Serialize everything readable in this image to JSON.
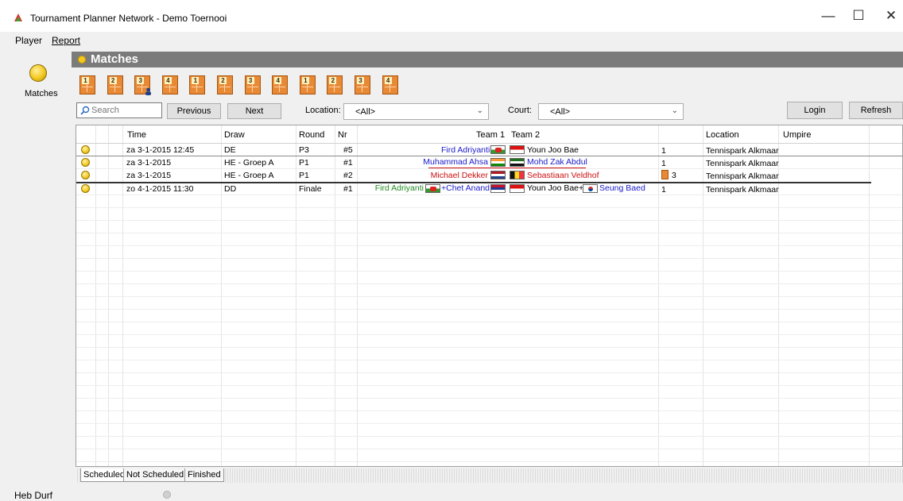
{
  "window": {
    "title": "Tournament Planner Network - Demo Toernooi",
    "minimize_glyph": "—",
    "maximize_glyph": "☐",
    "close_glyph": "✕"
  },
  "menu": {
    "player": "Player",
    "report": "Report"
  },
  "nav": {
    "matches_label": "Matches"
  },
  "header": {
    "title": "Matches"
  },
  "courts": [
    {
      "number": "1",
      "has_person": false
    },
    {
      "number": "2",
      "has_person": false
    },
    {
      "number": "3",
      "has_person": true
    },
    {
      "number": "4",
      "has_person": false
    },
    {
      "number": "1",
      "has_person": false
    },
    {
      "number": "2",
      "has_person": false
    },
    {
      "number": "3",
      "has_person": false
    },
    {
      "number": "4",
      "has_person": false
    },
    {
      "number": "1",
      "has_person": false
    },
    {
      "number": "2",
      "has_person": false
    },
    {
      "number": "3",
      "has_person": false
    },
    {
      "number": "4",
      "has_person": false
    }
  ],
  "toolbar": {
    "search_placeholder": "Search",
    "previous": "Previous",
    "next": "Next",
    "location_label": "Location:",
    "location_value": "<All>",
    "court_label": "Court:",
    "court_value": "<All>",
    "login": "Login",
    "refresh": "Refresh"
  },
  "columns": {
    "time": "Time",
    "draw": "Draw",
    "round": "Round",
    "nr": "Nr",
    "team1": "Team 1",
    "team2": "Team 2",
    "location": "Location",
    "umpire": "Umpire"
  },
  "rows": [
    {
      "time": "za 3-1-2015 12:45",
      "draw": "DE",
      "round": "P3",
      "nr": "#5",
      "team1": "Fird Adriyanti",
      "team2": "Youn Joo Bae",
      "court": "1",
      "location": "Tennispark Alkmaar"
    },
    {
      "time": "za 3-1-2015",
      "draw": "HE - Groep A",
      "round": "P1",
      "nr": "#1",
      "team1": "Muhammad Ahsa",
      "team2": "Mohd Zak Abdul",
      "court": "1",
      "location": "Tennispark Alkmaar"
    },
    {
      "time": "za 3-1-2015",
      "draw": "HE - Groep A",
      "round": "P1",
      "nr": "#2",
      "team1": "Michael Dekker",
      "team2": "Sebastiaan Veldhof",
      "court": "3",
      "location": "Tennispark Alkmaar"
    },
    {
      "time": "zo 4-1-2015 11:30",
      "draw": "DD",
      "round": "Finale",
      "nr": "#1",
      "team1_a": "Fird Adriyanti",
      "team1_b": "+Chet Anand",
      "team2_a": "Youn Joo Bae+",
      "team2_b": "Seung Baed",
      "court": "1",
      "location": "Tennispark Alkmaar"
    }
  ],
  "tabs": [
    "Scheduled",
    "Not Scheduled",
    "Finished"
  ],
  "status": {
    "user": "Heb Durf"
  },
  "colors": {
    "header_band": "#7b7b7b",
    "team_blue": "#1a1acc",
    "team_red": "#cc1111",
    "team_green": "#228b22",
    "court_orange": "#e88a35",
    "status_yellow": "#f2c81e"
  }
}
